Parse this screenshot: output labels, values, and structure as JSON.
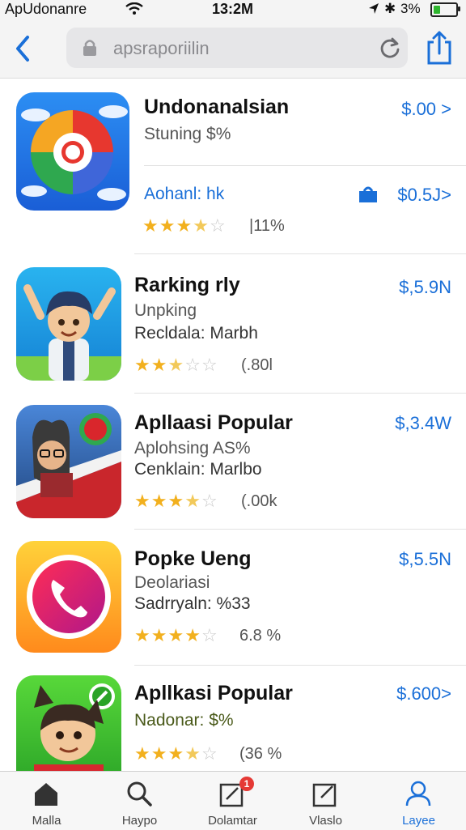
{
  "status_bar": {
    "carrier": "ApUdonanre",
    "time": "13:2M",
    "battery": "3%",
    "battery_level": 0.25
  },
  "nav": {
    "search_text": "apsraporiilin"
  },
  "apps": [
    {
      "title": "Undonanalsian",
      "subtitle": "Stuning $%",
      "price": "$.00 >",
      "sub2": "Aohanl: hk",
      "price2": "$0.5J>",
      "rating": 3.5,
      "rating_count": "|11%"
    },
    {
      "title": "Rarking rly",
      "subtitle": "Unpking",
      "sub2": "Recldala: Marbh",
      "price": "$,5.9N",
      "rating": 2.5,
      "rating_count": "(.80l"
    },
    {
      "title": "Apllaasi Popular",
      "subtitle": "Aplohsing AS%",
      "sub2": "Cenklain: Marlbo",
      "price": "$,3.4W",
      "rating": 3.5,
      "rating_count": "(.00k"
    },
    {
      "title": "Popke Ueng",
      "subtitle": "Deolariasi",
      "sub2": "Sadrryaln: %33",
      "price": "$,5.5N",
      "rating": 4,
      "rating_count": "6.8 %"
    },
    {
      "title": "Apllkasi  Popular",
      "subtitle": "Nadonar: $%",
      "price": "$.600>",
      "rating": 3.5,
      "rating_count": "(36 %"
    }
  ],
  "tabs": [
    {
      "label": "Malla",
      "icon": "home-icon",
      "active": false
    },
    {
      "label": "Haypo",
      "icon": "search-icon",
      "active": false
    },
    {
      "label": "Dolamtar",
      "icon": "updates-icon",
      "active": false,
      "badge": "1"
    },
    {
      "label": "Vlaslo",
      "icon": "edit-icon",
      "active": false
    },
    {
      "label": "Layee",
      "icon": "person-icon",
      "active": true
    }
  ],
  "colors": {
    "accent": "#1a6fd8",
    "star": "#f2b01e"
  }
}
